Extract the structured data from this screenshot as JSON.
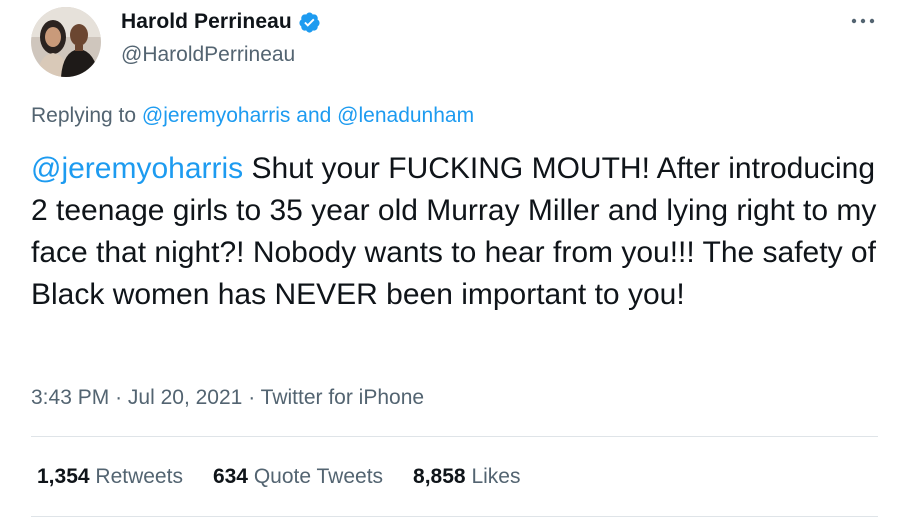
{
  "author": {
    "display_name": "Harold Perrineau",
    "handle": "@HaroldPerrineau",
    "verified_icon": "verified-badge-icon",
    "avatar_icon": "avatar-photo"
  },
  "more_icon": "more-options-icon",
  "replying": {
    "prefix": "Replying to",
    "mention1": "@jeremyoharris",
    "conjunction": "and",
    "mention2": "@lenadunham"
  },
  "tweet": {
    "mention": "@jeremyoharris",
    "text": " Shut your FUCKING MOUTH! After introducing 2 teenage girls to 35 year old Murray Miller and lying right to my face that night?! Nobody wants to hear from you!!! The safety of Black women has NEVER been important to you!"
  },
  "meta": {
    "time": "3:43 PM",
    "date": "Jul 20, 2021",
    "source": "Twitter for iPhone",
    "separator": "·"
  },
  "stats": {
    "retweets_count": "1,354",
    "retweets_label": "Retweets",
    "quotes_count": "634",
    "quotes_label": "Quote Tweets",
    "likes_count": "8,858",
    "likes_label": "Likes"
  },
  "colors": {
    "accent": "#1d9bf0",
    "secondary_text": "#536471",
    "primary_text": "#0f1419",
    "divider": "#dfe4e8"
  }
}
